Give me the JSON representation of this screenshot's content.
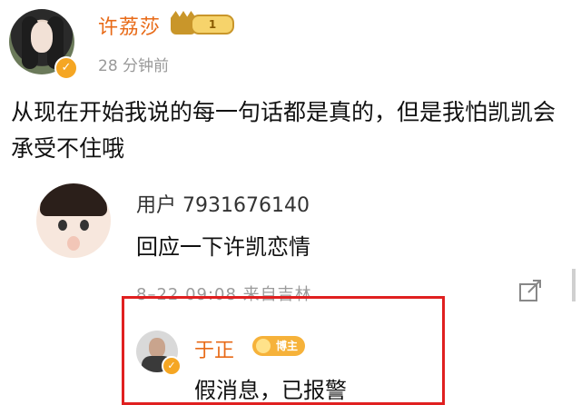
{
  "post": {
    "author_name": "许荔莎",
    "level_badge": "1",
    "time_ago": "28 分钟前",
    "text": "从现在开始我说的每一句话都是真的，但是我怕凯凯会承受不住哦"
  },
  "comment": {
    "user": "用户 7931676140",
    "text": "回应一下许凯恋情",
    "meta": "8–22 09:08 来自吉林"
  },
  "highlighted_reply": {
    "author_name": "于正",
    "badge_label": "博主",
    "text": "假消息，已报警"
  },
  "icons": {
    "verify": "verified-icon",
    "share": "share-icon",
    "crown": "crown-icon"
  },
  "colors": {
    "username_orange": "#e86a17",
    "highlight_red": "#e02020",
    "badge_gold": "#f6b23a"
  }
}
